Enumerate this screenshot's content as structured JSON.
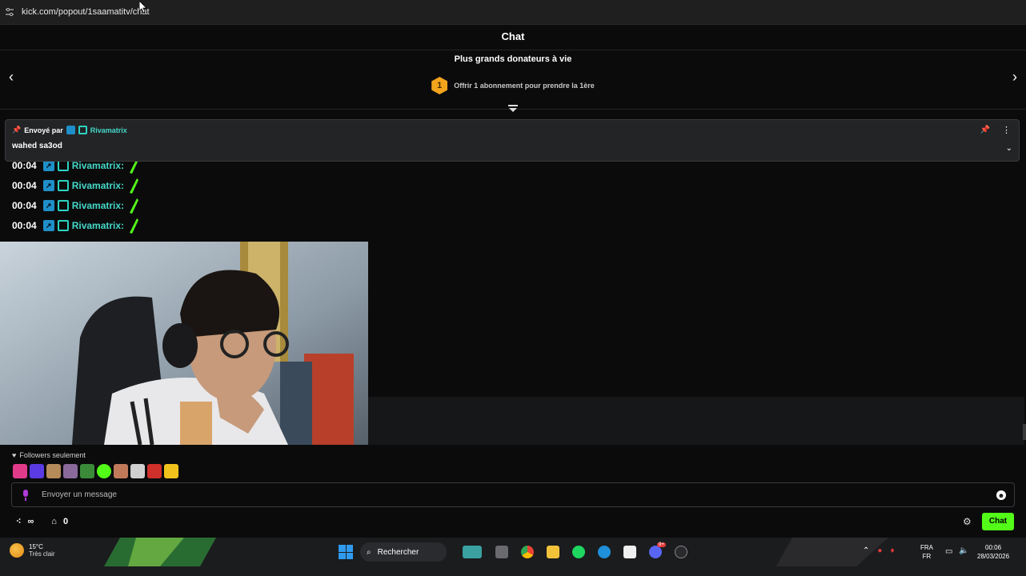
{
  "browser": {
    "url": "kick.com/popout/1saamatitv/chat"
  },
  "chat": {
    "title": "Chat",
    "donors_title": "Plus grands donateurs à vie",
    "donor_rank": "1",
    "donor_cta": "Offrir 1 abonnement pour prendre la 1ère"
  },
  "pinned": {
    "sent_by": "Envoyé par",
    "username": "Rivamatrix",
    "message": "wahed sa3od"
  },
  "messages": [
    {
      "time": "00:04",
      "username": "Rivamatrix:"
    },
    {
      "time": "00:04",
      "username": "Rivamatrix:"
    },
    {
      "time": "00:04",
      "username": "Rivamatrix:"
    },
    {
      "time": "00:04",
      "username": "Rivamatrix:"
    }
  ],
  "composer": {
    "followers_only": "Followers seulement",
    "placeholder": "Envoyer un message",
    "infinity": "∞",
    "store_count": "0",
    "chat_button": "Chat"
  },
  "taskbar": {
    "temperature": "15°C",
    "weather": "Très clair",
    "search": "Rechercher",
    "lang_1": "FRA",
    "lang_2": "FR",
    "time": "00:06",
    "date": "28/03/2026",
    "discord_badge": "9+"
  },
  "colors": {
    "accent": "#53fc18",
    "username": "#45d8c8",
    "donor_badge": "#f2a41c"
  }
}
